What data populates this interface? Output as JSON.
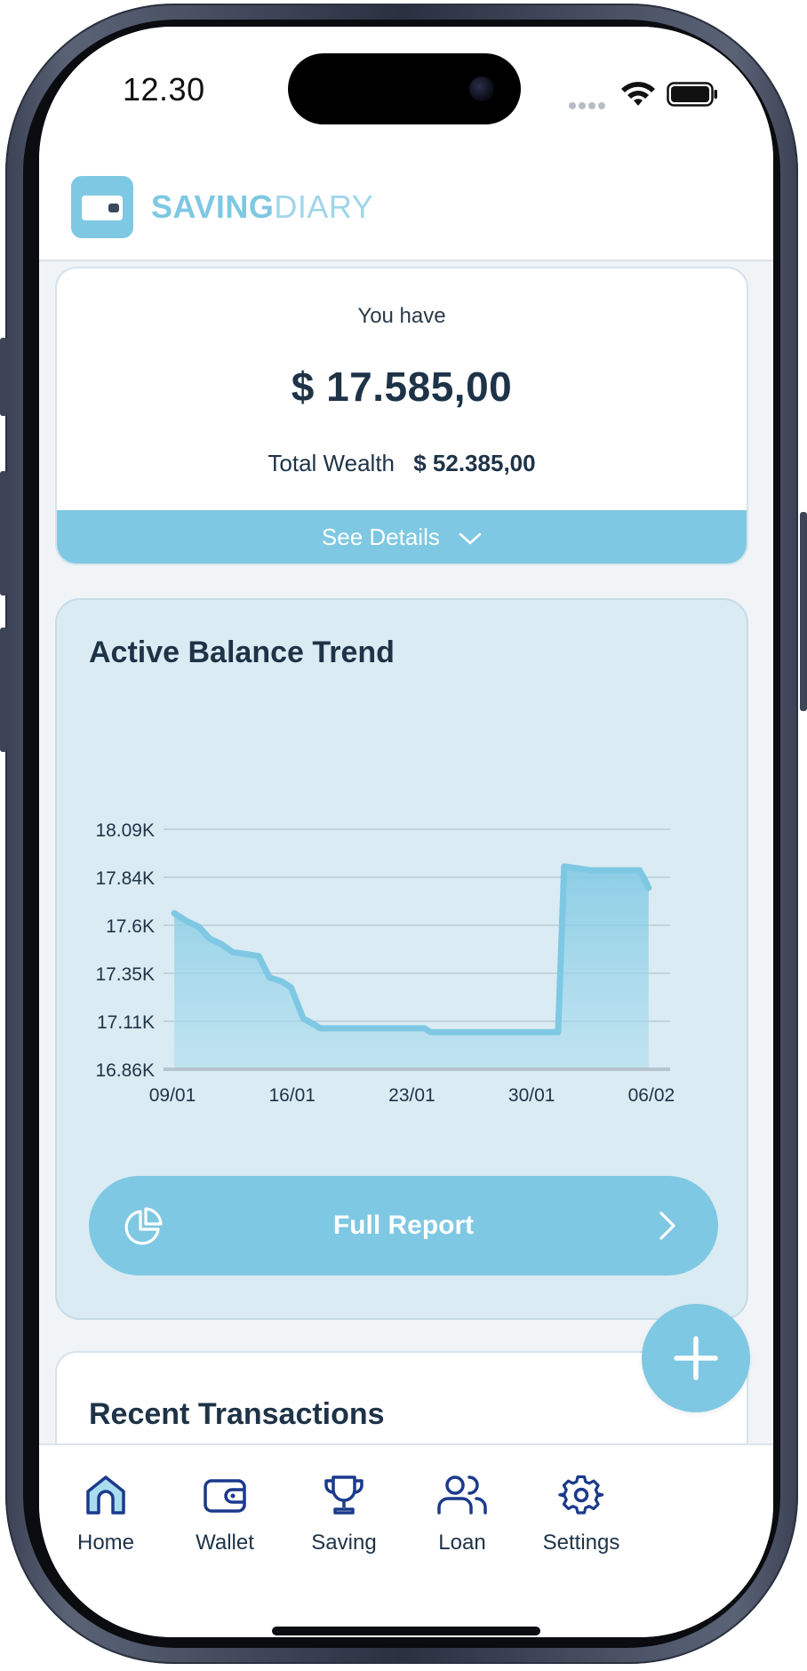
{
  "status_bar": {
    "time": "12.30"
  },
  "header": {
    "brand_primary": "SAVING",
    "brand_secondary": "DIARY",
    "icon": "wallet-icon"
  },
  "balance": {
    "label": "You have",
    "amount": "$ 17.585,00",
    "total_wealth_label": "Total Wealth",
    "total_wealth_value": "$ 52.385,00",
    "details_label": "See Details"
  },
  "trend": {
    "title": "Active Balance Trend",
    "full_report_label": "Full Report"
  },
  "chart_data": {
    "type": "area",
    "title": "Active Balance Trend",
    "x_ticks": [
      "09/01",
      "16/01",
      "23/01",
      "30/01",
      "06/02"
    ],
    "y_ticks": [
      "18.09K",
      "17.84K",
      "17.6K",
      "17.35K",
      "17.11K",
      "16.86K"
    ],
    "ylim": [
      16860,
      18090
    ],
    "xlim": [
      0,
      33
    ],
    "grid": true,
    "series": [
      {
        "x": [
          0.7,
          1.5,
          2.3,
          3.0,
          3.8,
          4.5,
          5.4,
          6.2,
          6.9,
          7.7,
          8.3,
          9.1,
          9.8,
          10.2,
          10.7,
          11.2,
          14,
          17,
          17.4,
          18,
          20,
          23,
          23.4,
          25.7,
          26.1,
          27.8,
          28.6,
          29.3,
          30.4,
          31.0,
          31.3,
          31.6
        ],
        "y": [
          17660,
          17620,
          17590,
          17530,
          17500,
          17460,
          17450,
          17440,
          17330,
          17310,
          17280,
          17120,
          17090,
          17070,
          17070,
          17070,
          17070,
          17070,
          17050,
          17050,
          17050,
          17050,
          17050,
          17050,
          17900,
          17880,
          17880,
          17880,
          17880,
          17880,
          17840,
          17790
        ]
      }
    ]
  },
  "recent": {
    "title": "Recent Transactions"
  },
  "colors": {
    "accent": "#7ec8e3",
    "text_dark": "#1e3347",
    "nav_icon": "#1b3a8c",
    "card_tint": "#daebf3"
  },
  "nav": {
    "items": [
      {
        "label": "Home",
        "icon": "home-icon"
      },
      {
        "label": "Wallet",
        "icon": "wallet-icon"
      },
      {
        "label": "Saving",
        "icon": "trophy-icon"
      },
      {
        "label": "Loan",
        "icon": "users-icon"
      },
      {
        "label": "Settings",
        "icon": "gear-icon"
      }
    ]
  }
}
